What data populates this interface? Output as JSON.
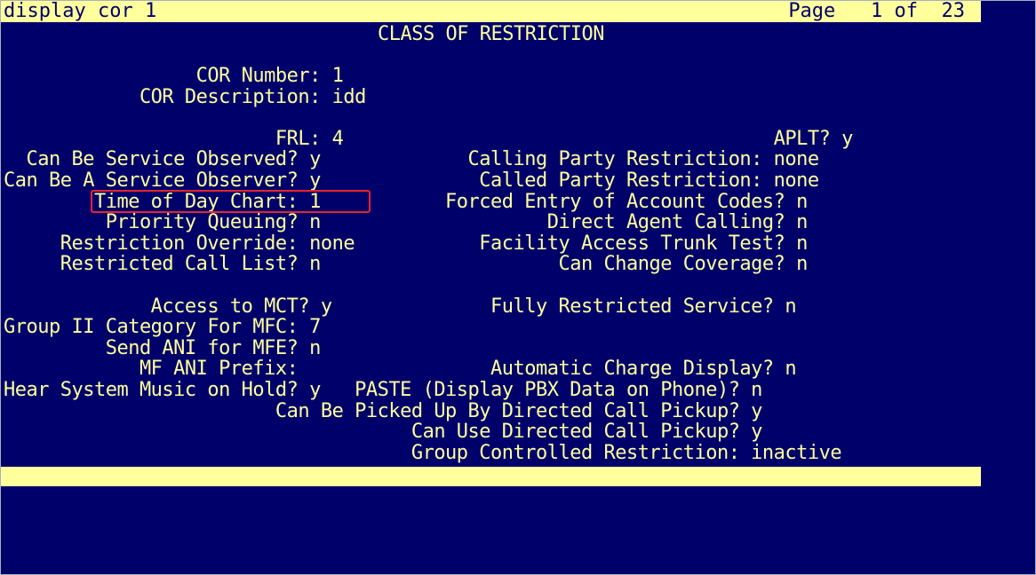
{
  "command": "display cor 1",
  "page_indicator": "Page   1 of  23",
  "screen_title": "CLASS OF RESTRICTION",
  "lines": [
    "                 COR Number: 1",
    "            COR Description: idd",
    "",
    "                        FRL: 4                                      APLT? y",
    "  Can Be Service Observed? y             Calling Party Restriction: none",
    "Can Be A Service Observer? y              Called Party Restriction: none",
    "        Time of Day Chart: 1           Forced Entry of Account Codes? n",
    "         Priority Queuing? n                    Direct Agent Calling? n",
    "     Restriction Override: none           Facility Access Trunk Test? n",
    "     Restricted Call List? n                     Can Change Coverage? n",
    "",
    "             Access to MCT? y              Fully Restricted Service? n",
    "Group II Category For MFC: 7",
    "         Send ANI for MFE? n",
    "            MF ANI Prefix:                 Automatic Charge Display? n",
    "Hear System Music on Hold? y   PASTE (Display PBX Data on Phone)? n",
    "                        Can Be Picked Up By Directed Call Pickup? y",
    "                                    Can Use Directed Call Pickup? y",
    "                                    Group Controlled Restriction: inactive"
  ],
  "colors": {
    "background": "#00006b",
    "foreground": "#ffff9c",
    "highlight_border": "#e8252a"
  }
}
